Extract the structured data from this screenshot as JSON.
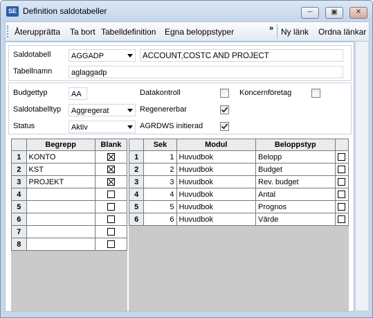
{
  "window": {
    "title": "Definition saldotabeller",
    "icon_text": "SE"
  },
  "toolbar": {
    "restore": "Återupprätta",
    "delete": "Ta bort",
    "table_def": "Tabelldefinition",
    "own_amount_types": "Egna beloppstyper",
    "more": "»",
    "new_link": "Ny länk",
    "arrange_links": "Ordna länkar"
  },
  "form": {
    "saldotabell_label": "Saldotabell",
    "saldotabell_value": "AGGADP",
    "description_value": "ACCOUNT,COSTC AND PROJECT",
    "tabellnamn_label": "Tabellnamn",
    "tabellnamn_value": "aglaggadp",
    "budgettyp_label": "Budgettyp",
    "budgettyp_value": "AA",
    "saldotabelltyp_label": "Saldotabelltyp",
    "saldotabelltyp_value": "Aggregerat",
    "status_label": "Status",
    "status_value": "Aktiv",
    "datakontroll_label": "Datakontroll",
    "datakontroll_checked": false,
    "koncernforetag_label": "Koncernföretag",
    "koncernforetag_checked": false,
    "regenererbar_label": "Regenererbar",
    "regenererbar_checked": true,
    "agrdws_label": "AGRDWS initierad",
    "agrdws_checked": true
  },
  "left_grid": {
    "headers": {
      "begrepp": "Begrepp",
      "blank": "Blank"
    },
    "rows": [
      {
        "n": "1",
        "begrepp": "KONTO",
        "blank": true
      },
      {
        "n": "2",
        "begrepp": "KST",
        "blank": true
      },
      {
        "n": "3",
        "begrepp": "PROJEKT",
        "blank": true
      },
      {
        "n": "4",
        "begrepp": "",
        "blank": false
      },
      {
        "n": "5",
        "begrepp": "",
        "blank": false
      },
      {
        "n": "6",
        "begrepp": "",
        "blank": false
      },
      {
        "n": "7",
        "begrepp": "",
        "blank": false
      },
      {
        "n": "8",
        "begrepp": "",
        "blank": false
      }
    ]
  },
  "right_grid": {
    "headers": {
      "sek": "Sek",
      "modul": "Modul",
      "beloppstyp": "Beloppstyp"
    },
    "rows": [
      {
        "n": "1",
        "sek": "1",
        "modul": "Huvudbok",
        "beloppstyp": "Belopp"
      },
      {
        "n": "2",
        "sek": "2",
        "modul": "Huvudbok",
        "beloppstyp": "Budget"
      },
      {
        "n": "3",
        "sek": "3",
        "modul": "Huvudbok",
        "beloppstyp": "Rev. budget"
      },
      {
        "n": "4",
        "sek": "4",
        "modul": "Huvudbok",
        "beloppstyp": "Antal"
      },
      {
        "n": "5",
        "sek": "5",
        "modul": "Huvudbok",
        "beloppstyp": "Prognos"
      },
      {
        "n": "6",
        "sek": "6",
        "modul": "Huvudbok",
        "beloppstyp": "Värde"
      }
    ]
  }
}
